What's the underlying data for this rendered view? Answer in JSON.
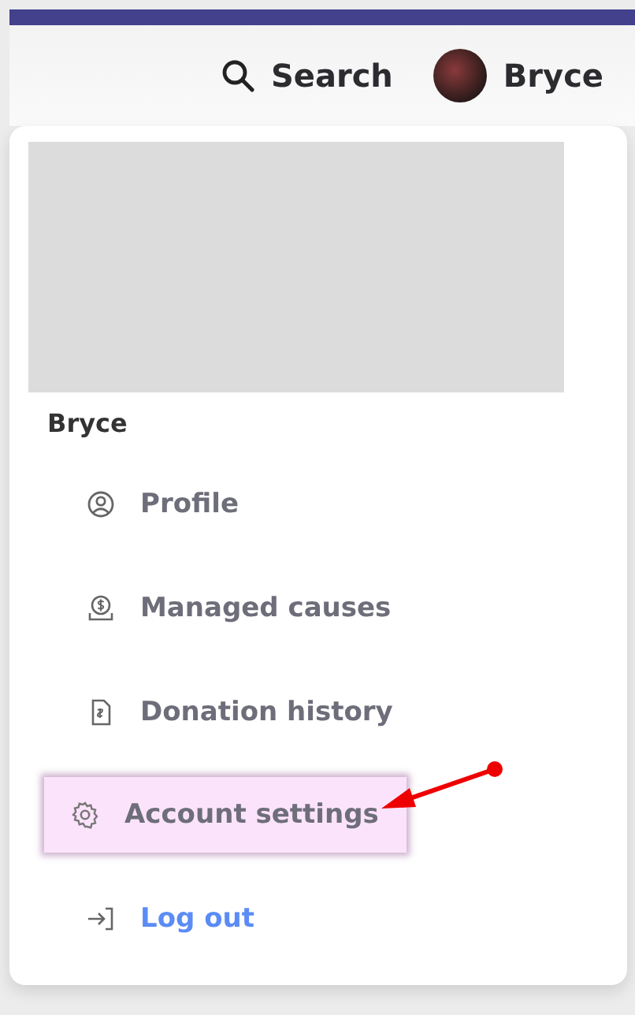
{
  "header": {
    "search": "Search",
    "user_name": "Bryce"
  },
  "menu": {
    "user_name": "Bryce",
    "items": [
      {
        "label": "Profile",
        "kind": "item",
        "highlighted": false
      },
      {
        "label": "Managed causes",
        "kind": "item",
        "highlighted": false
      },
      {
        "label": "Donation history",
        "kind": "item",
        "highlighted": false
      },
      {
        "label": "Account settings",
        "kind": "item",
        "highlighted": true
      },
      {
        "label": "Log out",
        "kind": "link",
        "highlighted": false
      }
    ]
  }
}
